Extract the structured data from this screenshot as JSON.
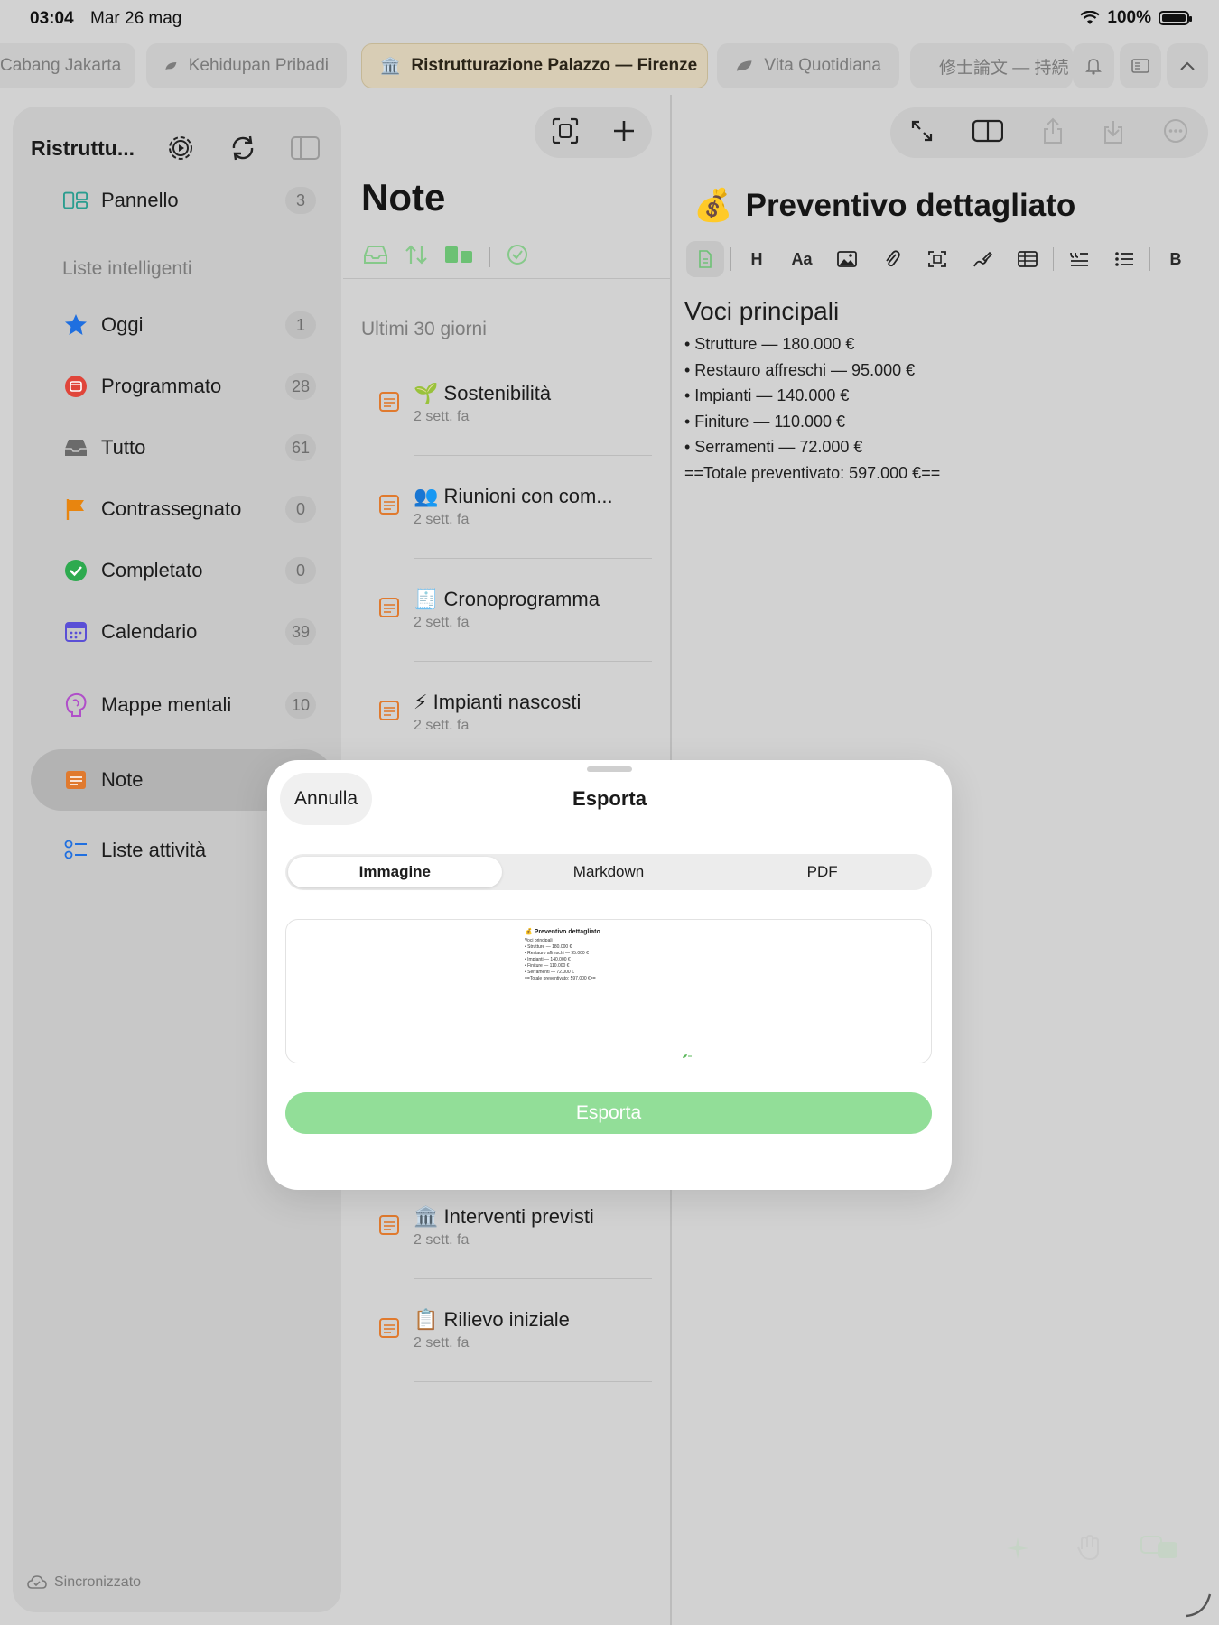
{
  "status": {
    "time": "03:04",
    "date": "Mar 26 mag",
    "battery": "100%"
  },
  "tabs": [
    {
      "label": "Cabang Jakarta",
      "active": false
    },
    {
      "label": "Kehidupan Pribadi",
      "active": false
    },
    {
      "label": "Ristrutturazione Palazzo — Firenze",
      "active": true
    },
    {
      "label": "Vita Quotidiana",
      "active": false
    },
    {
      "label": "修士論文 — 持続",
      "active": false
    }
  ],
  "sidebar": {
    "title": "Ristruttu...",
    "dashboard": {
      "label": "Pannello",
      "count": "3"
    },
    "smart_header": "Liste intelligenti",
    "items": [
      {
        "label": "Oggi",
        "count": "1",
        "icon": "star-icon"
      },
      {
        "label": "Programmato",
        "count": "28",
        "icon": "calendar-clock-icon"
      },
      {
        "label": "Tutto",
        "count": "61",
        "icon": "inbox-icon"
      },
      {
        "label": "Contrassegnato",
        "count": "0",
        "icon": "flag-icon"
      },
      {
        "label": "Completato",
        "count": "0",
        "icon": "checkmark-circle-icon"
      },
      {
        "label": "Calendario",
        "count": "39",
        "icon": "calendar-icon"
      },
      {
        "label": "Mappe mentali",
        "count": "10",
        "icon": "brain-icon"
      },
      {
        "label": "Note",
        "count": "",
        "icon": "note-icon"
      },
      {
        "label": "Liste attività",
        "count": "",
        "icon": "checklist-icon"
      }
    ],
    "sync_status": "Sincronizzato"
  },
  "notes": {
    "title": "Note",
    "section": "Ultimi 30 giorni",
    "items": [
      {
        "emoji": "🌱",
        "title": "Sostenibilità",
        "age": "2 sett. fa"
      },
      {
        "emoji": "👥",
        "title": "Riunioni con com...",
        "age": "2 sett. fa"
      },
      {
        "emoji": "🧾",
        "title": "Cronoprogramma",
        "age": "2 sett. fa"
      },
      {
        "emoji": "⚡",
        "title": "Impianti nascosti",
        "age": "2 sett. fa"
      },
      {
        "emoji": "🏛️",
        "title": "Interventi previsti",
        "age": "2 sett. fa"
      },
      {
        "emoji": "📋",
        "title": "Rilievo iniziale",
        "age": "2 sett. fa"
      }
    ]
  },
  "editor": {
    "emoji": "💰",
    "title": "Preventivo dettagliato",
    "toolbar": {
      "heading": "H",
      "font": "Aa",
      "bold": "B"
    },
    "heading": "Voci principali",
    "lines": [
      "• Strutture — 180.000 €",
      "• Restauro affreschi — 95.000 €",
      "• Impianti — 140.000 €",
      "• Finiture — 110.000 €",
      "• Serramenti — 72.000 €",
      "==Totale preventivato: 597.000 €=="
    ]
  },
  "modal": {
    "cancel": "Annulla",
    "title": "Esporta",
    "formats": [
      "Immagine",
      "Markdown",
      "PDF"
    ],
    "selected_format": "Immagine",
    "export_button": "Esporta",
    "preview": {
      "title": "💰 Preventivo dettagliato",
      "lines": [
        "Voci principali",
        "• Strutture — 180.000 €",
        "• Restauro affreschi — 95.000 €",
        "• Impianti — 140.000 €",
        "• Finiture — 110.000 €",
        "• Serramenti — 72.000 €",
        "==Totale preventivato: 597.000 €=="
      ]
    }
  },
  "colors": {
    "accent_green": "#92de98",
    "note_orange": "#e07a2e",
    "star_blue": "#1f6fe0"
  }
}
